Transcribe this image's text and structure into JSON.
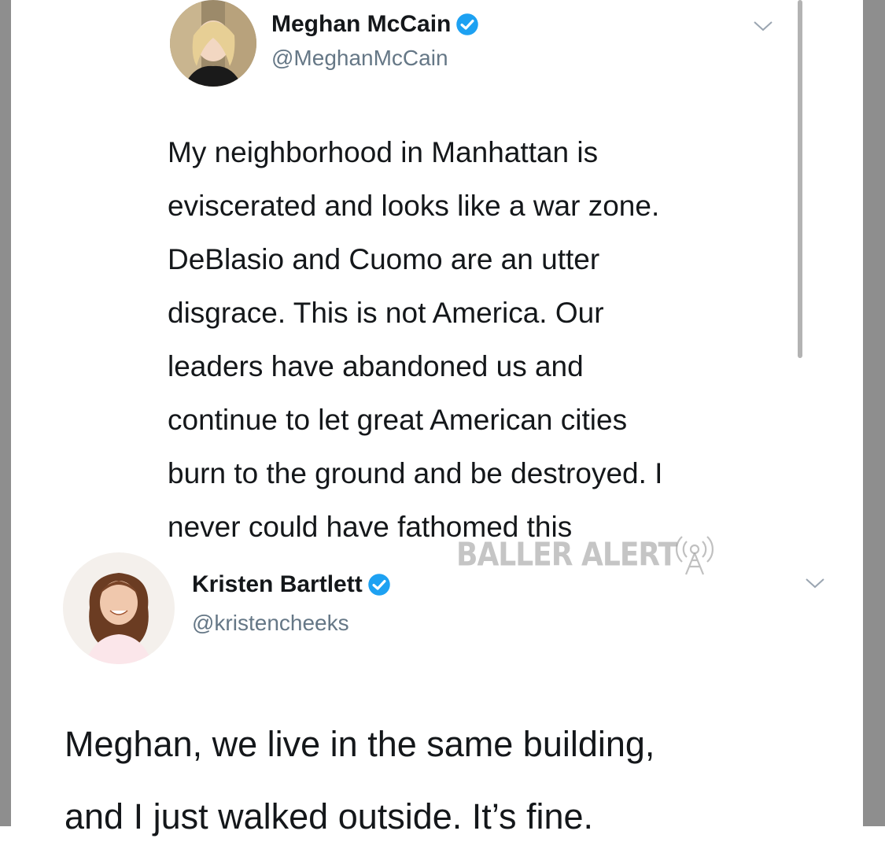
{
  "tweets": [
    {
      "display_name": "Meghan McCain",
      "handle": "@MeghanMcCain",
      "verified": true,
      "text_lines": [
        "My neighborhood in Manhattan is",
        "eviscerated and looks like a war zone.",
        "DeBlasio and Cuomo are an utter",
        "disgrace. This is not America. Our",
        "leaders have abandoned us and",
        "continue to let great American cities",
        "burn to the ground and be destroyed. I",
        "never could have fathomed this"
      ]
    },
    {
      "display_name": "Kristen Bartlett",
      "handle": "@kristencheeks",
      "verified": true,
      "text_lines": [
        "Meghan, we live in the same building,",
        "and I just walked outside. It’s fine."
      ]
    }
  ],
  "watermark": "BALLER ALERT",
  "colors": {
    "verified_badge": "#1da1f2",
    "name_text": "#14171a",
    "handle_text": "#657786",
    "side_border": "#8e8e8e"
  },
  "icons": {
    "verified": "verified-badge-icon",
    "menu": "chevron-down-icon",
    "watermark_logo": "broadcast-tower-icon"
  }
}
